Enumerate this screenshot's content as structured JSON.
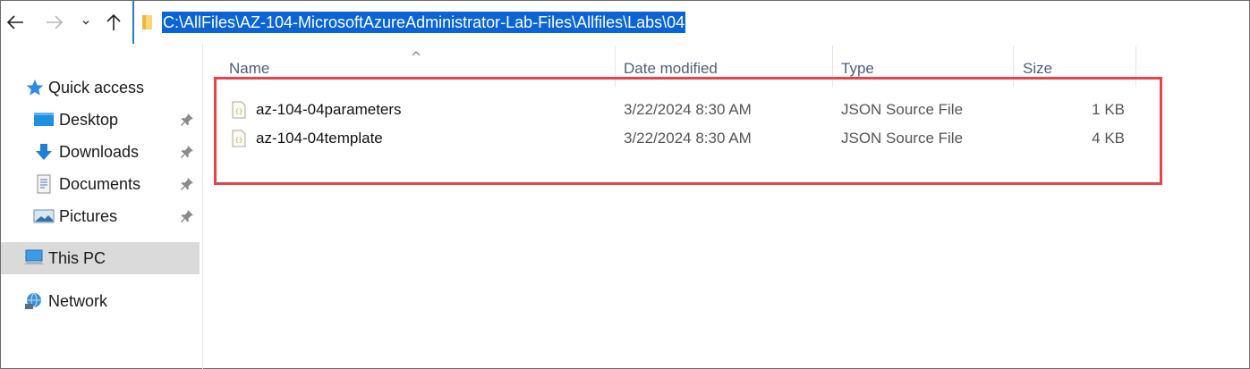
{
  "address_bar": {
    "path": "C:\\AllFiles\\AZ-104-MicrosoftAzureAdministrator-Lab-Files\\Allfiles\\Labs\\04"
  },
  "nav_buttons": {
    "back_icon": "arrow-left-icon",
    "forward_icon": "arrow-right-icon",
    "recent_icon": "chevron-down-icon",
    "up_icon": "arrow-up-icon"
  },
  "sidebar": {
    "items": [
      {
        "label": "Quick access",
        "icon": "star-icon"
      },
      {
        "label": "Desktop",
        "icon": "desktop-icon",
        "pinned": true
      },
      {
        "label": "Downloads",
        "icon": "download-icon",
        "pinned": true
      },
      {
        "label": "Documents",
        "icon": "documents-icon",
        "pinned": true
      },
      {
        "label": "Pictures",
        "icon": "pictures-icon",
        "pinned": true
      },
      {
        "label": "This PC",
        "icon": "computer-icon",
        "selected": true
      },
      {
        "label": "Network",
        "icon": "network-icon"
      }
    ]
  },
  "columns": {
    "name": "Name",
    "date_modified": "Date modified",
    "type": "Type",
    "size": "Size"
  },
  "files": [
    {
      "name": "az-104-04parameters",
      "date_modified": "3/22/2024 8:30 AM",
      "type": "JSON Source File",
      "size": "1 KB",
      "icon": "json-file-icon"
    },
    {
      "name": "az-104-04template",
      "date_modified": "3/22/2024 8:30 AM",
      "type": "JSON Source File",
      "size": "4 KB",
      "icon": "json-file-icon"
    }
  ],
  "colors": {
    "selection_highlight": "#0a64d6",
    "annotation_box": "#e8434b",
    "selected_nav_bg": "#dadada",
    "column_header_text": "#4c607a"
  }
}
